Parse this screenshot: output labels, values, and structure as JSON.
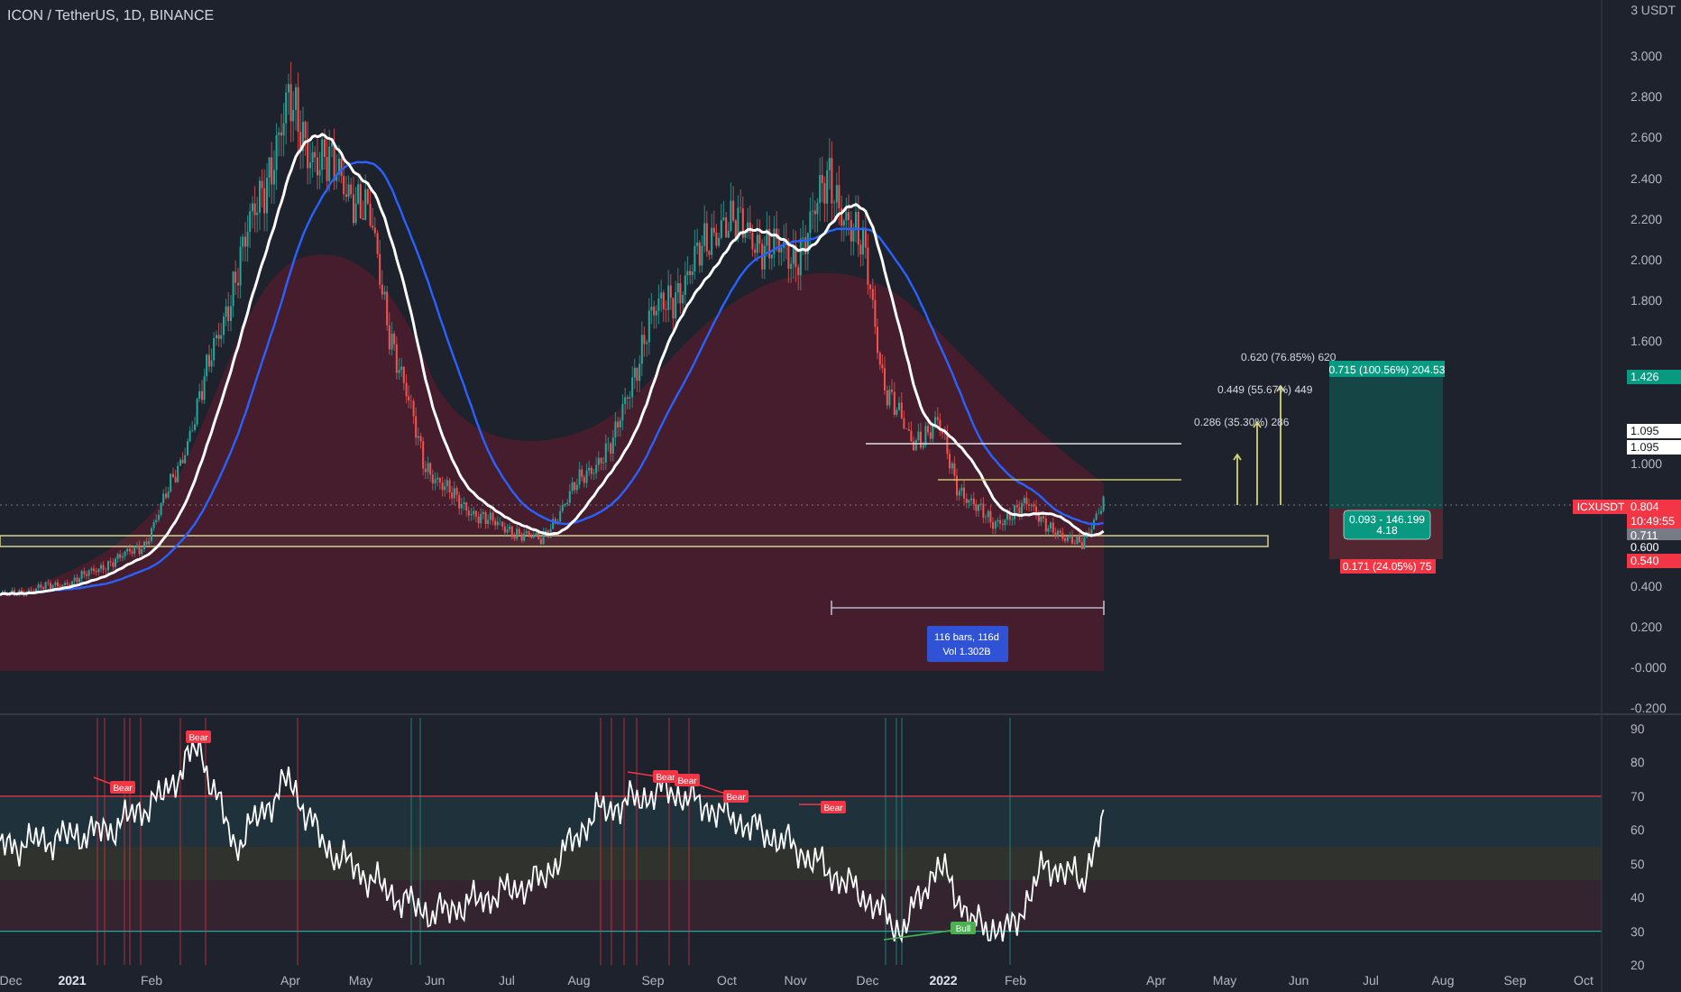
{
  "header": {
    "title": "ICON / TetherUS, 1D, BINANCE"
  },
  "price_axis": {
    "unit": "3 USDT",
    "ticks": [
      "3.000",
      "2.800",
      "2.600",
      "2.400",
      "2.200",
      "2.000",
      "1.800",
      "1.600",
      "1.000",
      "0.400",
      "0.200",
      "-0.000",
      "-0.200"
    ]
  },
  "price_labels": [
    {
      "text": "1.426",
      "color": "#089981"
    },
    {
      "text": "1.095",
      "color": "#ffffff"
    },
    {
      "text": "1.095",
      "color": "#ffffff"
    },
    {
      "text": "0.804",
      "color": "#f23645"
    },
    {
      "text": "10:49:55",
      "color": "#f23645"
    },
    {
      "text": "0.711",
      "color": "#787b86"
    },
    {
      "text": "0.600",
      "color": "#1e222d"
    },
    {
      "text": "0.540",
      "color": "#f23645"
    }
  ],
  "symbol_label": "ICXUSDT",
  "fib_labels": [
    "0.620 (76.85%) 620",
    "0.449 (55.67%) 449",
    "0.286 (35.30%) 286"
  ],
  "position": {
    "target": "0.715 (100.56%) 204.53",
    "stats": [
      "0.093 - 146.199",
      "4.18"
    ],
    "stop": "0.171 (24.05%) 75"
  },
  "measure": {
    "lines": [
      "116 bars, 116d",
      "Vol 1.302B"
    ]
  },
  "rsi": {
    "ticks": [
      "90",
      "80",
      "70",
      "60",
      "50",
      "40",
      "30",
      "20"
    ],
    "markers": [
      {
        "kind": "bear",
        "label": "Bear"
      },
      {
        "kind": "bear",
        "label": "Bear"
      },
      {
        "kind": "bear",
        "label": "Bear"
      },
      {
        "kind": "bear",
        "label": "Bear"
      },
      {
        "kind": "bear",
        "label": "Bear"
      },
      {
        "kind": "bear",
        "label": "Bear"
      },
      {
        "kind": "bull",
        "label": "Bull"
      }
    ]
  },
  "time_axis": [
    {
      "label": "Dec",
      "kind": "month"
    },
    {
      "label": "2021",
      "kind": "year"
    },
    {
      "label": "Feb",
      "kind": "month"
    },
    {
      "label": "Apr",
      "kind": "month"
    },
    {
      "label": "May",
      "kind": "month"
    },
    {
      "label": "Jun",
      "kind": "month"
    },
    {
      "label": "Jul",
      "kind": "month"
    },
    {
      "label": "Aug",
      "kind": "month"
    },
    {
      "label": "Sep",
      "kind": "month"
    },
    {
      "label": "Oct",
      "kind": "month"
    },
    {
      "label": "Nov",
      "kind": "month"
    },
    {
      "label": "Dec",
      "kind": "month"
    },
    {
      "label": "2022",
      "kind": "year"
    },
    {
      "label": "Feb",
      "kind": "month"
    },
    {
      "label": "Apr",
      "kind": "month"
    },
    {
      "label": "May",
      "kind": "month"
    },
    {
      "label": "Jun",
      "kind": "month"
    },
    {
      "label": "Jul",
      "kind": "month"
    },
    {
      "label": "Aug",
      "kind": "month"
    },
    {
      "label": "Sep",
      "kind": "month"
    },
    {
      "label": "Oct",
      "kind": "month"
    }
  ]
}
